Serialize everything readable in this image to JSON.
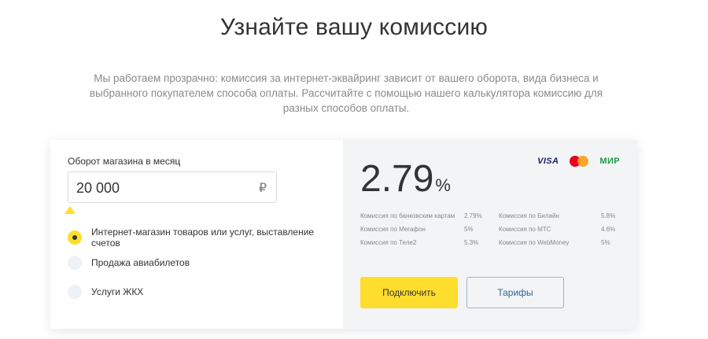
{
  "header": {
    "title": "Узнайте вашу комиссию",
    "subtitle_line1": "Мы работаем прозрачно: комиссия за интернет-эквайринг зависит от вашего оборота, вида бизнеса и",
    "subtitle_line2": "выбранного покупателем способа оплаты. Рассчитайте с помощью нашего калькулятора комиссию для",
    "subtitle_line3": "разных способов оплаты."
  },
  "calculator": {
    "turnover_label": "Оборот магазина в месяц",
    "turnover_value": "20 000",
    "currency_symbol": "₽",
    "slider_position": 0,
    "options": [
      {
        "label": "Интернет-магазин товаров или услуг, выставление счетов",
        "selected": true
      },
      {
        "label": "Продажа авиабилетов",
        "selected": false
      },
      {
        "label": "Услуги ЖКХ",
        "selected": false
      }
    ]
  },
  "result": {
    "rate_value": "2.79",
    "rate_unit": "%",
    "logos": {
      "visa": "VISA",
      "mir": "МИР",
      "mastercard_icon": "mastercard-logo"
    },
    "fees": [
      {
        "name": "Комиссия по банковским картам",
        "value": "2.79%"
      },
      {
        "name": "Комиссия по Билайн",
        "value": "5.8%"
      },
      {
        "name": "Комиссия по Мегафон",
        "value": "5%"
      },
      {
        "name": "Комиссия по МТС",
        "value": "4.6%"
      },
      {
        "name": "Комиссия по Теле2",
        "value": "5.3%"
      },
      {
        "name": "Комиссия по WebMoney",
        "value": "5%"
      }
    ],
    "connect_button": "Подключить",
    "tariffs_button": "Тарифы"
  },
  "colors": {
    "accent_yellow": "#ffdd2d",
    "text_dark": "#333333",
    "text_muted": "#8a8a8a",
    "panel_gray": "#f3f4f6",
    "link_blue": "#336699"
  }
}
